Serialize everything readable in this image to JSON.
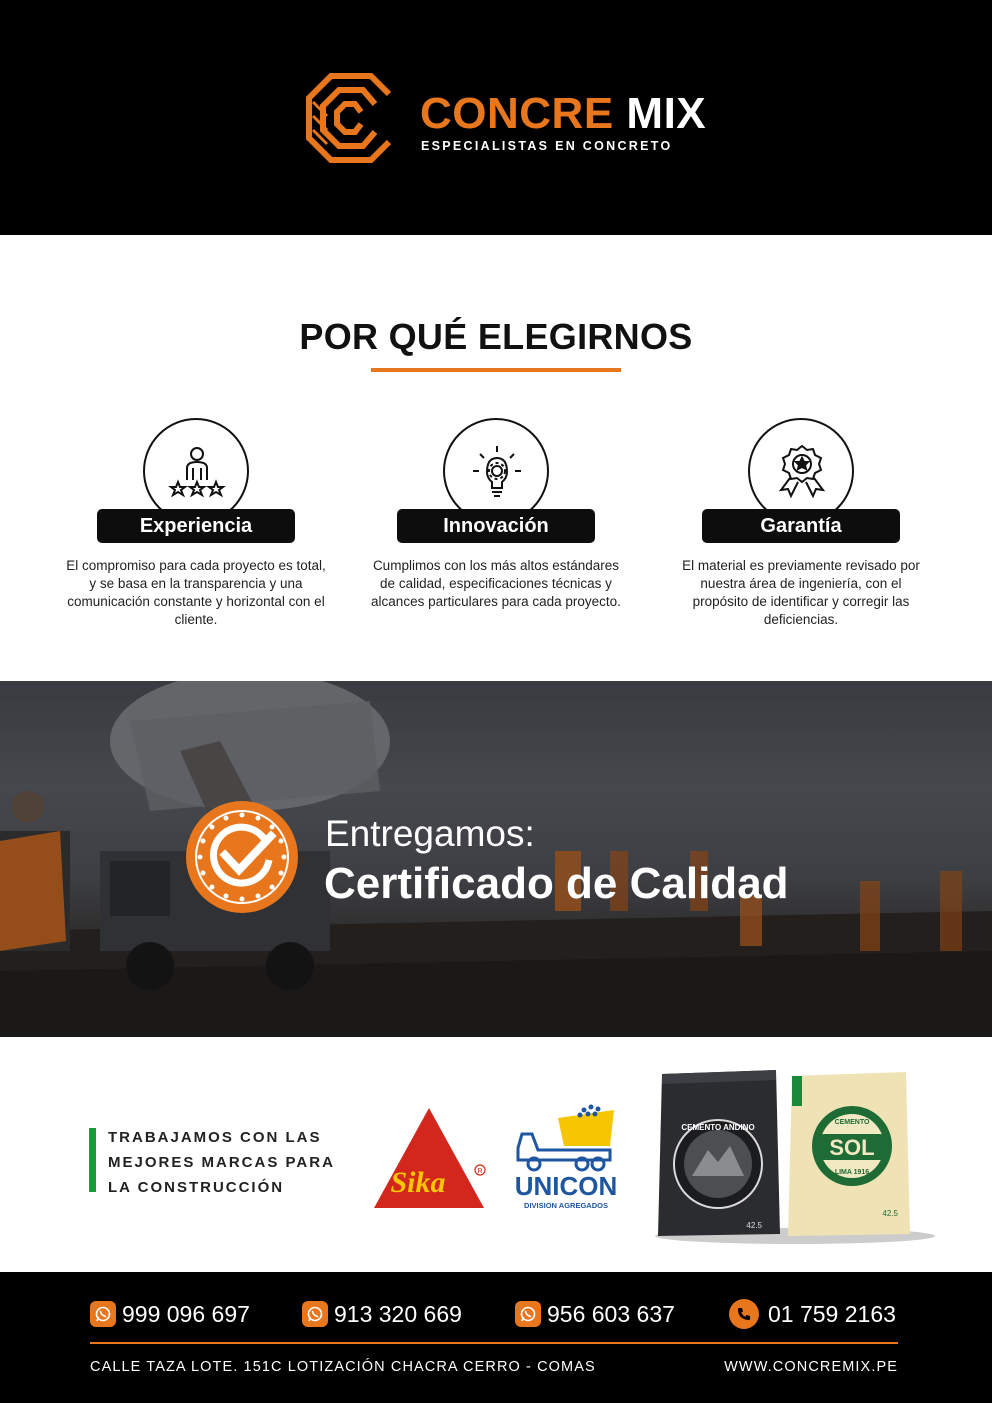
{
  "header": {
    "brand_part1": "CONCRE",
    "brand_part2": "MIX",
    "tagline": "ESPECIALISTAS EN CONCRETO"
  },
  "why": {
    "title": "POR QUÉ ELEGIRNOS",
    "features": [
      {
        "icon": "team-rating-icon",
        "label": "Experiencia",
        "text": "El compromiso para cada proyecto es total, y se basa en la transparencia y una comunicación constante y horizontal con el cliente."
      },
      {
        "icon": "lightbulb-gear-icon",
        "label": "Innovación",
        "text": "Cumplimos con los más altos estándares de calidad, especificaciones técnicas y alcances particulares para cada proyecto."
      },
      {
        "icon": "award-ribbon-icon",
        "label": "Garantía",
        "text": "El material es previamente revisado por nuestra área de ingeniería, con el propósito de identificar y corregir las deficiencias."
      }
    ]
  },
  "banner": {
    "line1": "Entregamos:",
    "line2": "Certificado de Calidad",
    "badge_icon": "check-seal-icon"
  },
  "brands": {
    "text": "TRABAJAMOS CON LAS MEJORES MARCAS PARA LA CONSTRUCCIÓN",
    "sika": "Sika",
    "unicon": "UNICON",
    "unicon_sub": "DIVISION AGREGADOS",
    "andino": "CEMENTO ANDINO",
    "sol": "SOL",
    "sol_top": "CEMENTO",
    "sol_sub": "LIMA 1916",
    "bag_weight": "42.5"
  },
  "footer": {
    "phones": [
      "999 096 697",
      "913 320 669",
      "956 603 637"
    ],
    "landline": "01 759 2163",
    "address": "CALLE TAZA LOTE. 151C LOTIZACIÓN CHACRA CERRO - COMAS",
    "website": "WWW.CONCREMIX.PE"
  },
  "colors": {
    "accent": "#e8761c",
    "dark": "#000000",
    "green_bar": "#1a9a3a"
  }
}
